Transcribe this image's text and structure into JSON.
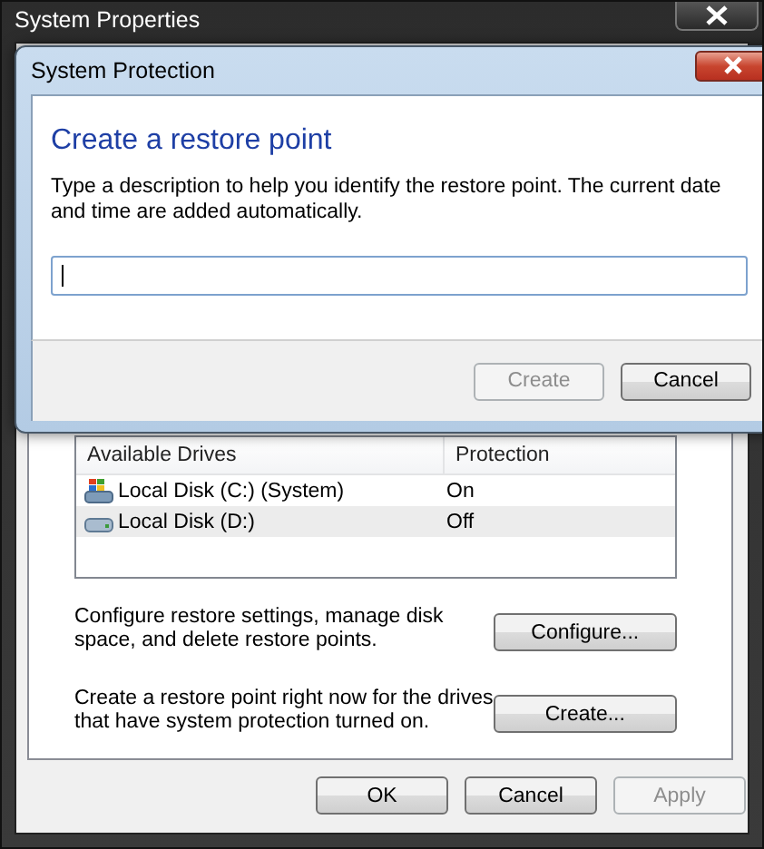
{
  "window": {
    "title": "System Properties"
  },
  "drives": {
    "columns": [
      "Available Drives",
      "Protection"
    ],
    "rows": [
      {
        "name": "Local Disk (C:) (System)",
        "protection": "On",
        "kind": "system",
        "selected": false
      },
      {
        "name": "Local Disk (D:)",
        "protection": "Off",
        "kind": "disk",
        "selected": true
      }
    ]
  },
  "actions": [
    {
      "text": "Configure restore settings, manage disk space, and delete restore points.",
      "button": "Configure..."
    },
    {
      "text": "Create a restore point right now for the drives that have system protection turned on.",
      "button": "Create..."
    }
  ],
  "buttons": [
    {
      "label": "OK",
      "disabled": false
    },
    {
      "label": "Cancel",
      "disabled": false
    },
    {
      "label": "Apply",
      "disabled": true
    }
  ],
  "dialog": {
    "title": "System Protection",
    "heading": "Create a restore point",
    "description": "Type a description to help you identify the restore point. The current date and time are added automatically.",
    "buttons": [
      {
        "label": "Create",
        "disabled": true
      },
      {
        "label": "Cancel",
        "disabled": false
      }
    ]
  }
}
